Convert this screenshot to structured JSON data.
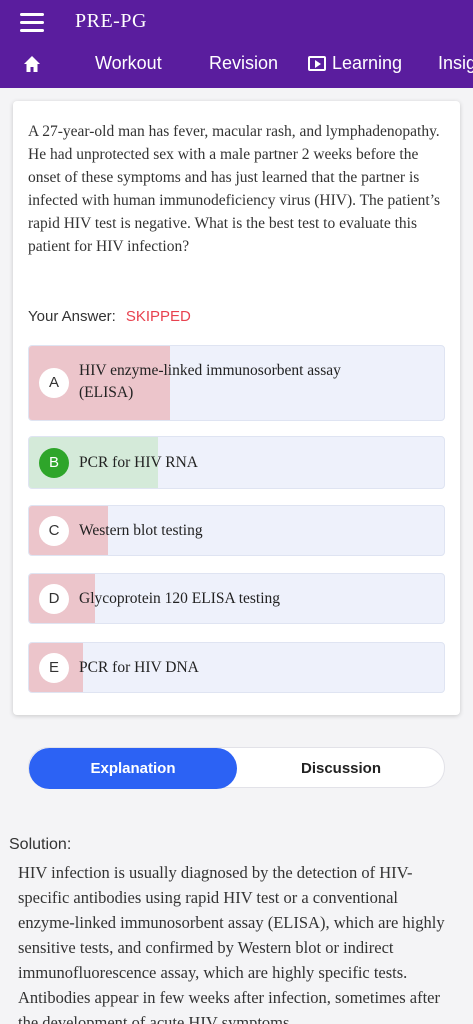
{
  "header": {
    "title": "PRE-PG",
    "nav": [
      {
        "label": "Workout"
      },
      {
        "label": "Revision"
      },
      {
        "label": "Learning"
      },
      {
        "label": "Insig"
      }
    ]
  },
  "question": {
    "text": "A 27-year-old man has fever, macular rash, and lymphadenopathy. He had unprotected sex with a male partner 2 weeks before the onset of these symptoms and has just learned that the partner is infected with human immunodeficiency virus (HIV). The patient’s rapid HIV test is negative. What is the best test to evaluate this patient for HIV infection?",
    "answer_label": "Your Answer:",
    "answer_value": "SKIPPED"
  },
  "options": [
    {
      "letter": "A",
      "text": "HIV enzyme-linked immunosorbent assay (ELISA)",
      "fill_fraction": 0.34,
      "fill_color": "#ecc5cb",
      "correct": false
    },
    {
      "letter": "B",
      "text": "PCR for HIV RNA",
      "fill_fraction": 0.31,
      "fill_color": "#d4ead9",
      "correct": true
    },
    {
      "letter": "C",
      "text": "Western blot testing",
      "fill_fraction": 0.19,
      "fill_color": "#ecc5cb",
      "correct": false
    },
    {
      "letter": "D",
      "text": "Glycoprotein 120 ELISA testing",
      "fill_fraction": 0.16,
      "fill_color": "#ecc5cb",
      "correct": false
    },
    {
      "letter": "E",
      "text": "PCR for HIV DNA",
      "fill_fraction": 0.13,
      "fill_color": "#ecc5cb",
      "correct": false
    }
  ],
  "tabs": {
    "explanation": "Explanation",
    "discussion": "Discussion"
  },
  "solution": {
    "label": "Solution:",
    "text": "HIV infection is usually diagnosed by the detection of HIV-specific antibodies using rapid HIV test or a conventional enzyme-linked immunosorbent assay (ELISA), which are highly sensitive tests, and confirmed by Western blot or indirect immunofluorescence assay, which are highly specific tests. Antibodies appear in few weeks after infection, sometimes after the development of acute HIV symptoms."
  },
  "colors": {
    "header": "#5a1d9e",
    "accent": "#2c62f4",
    "skipped": "#e8424f",
    "correct": "#2ea52a"
  },
  "icons": [
    "menu-icon",
    "home-icon",
    "learning-icon"
  ]
}
